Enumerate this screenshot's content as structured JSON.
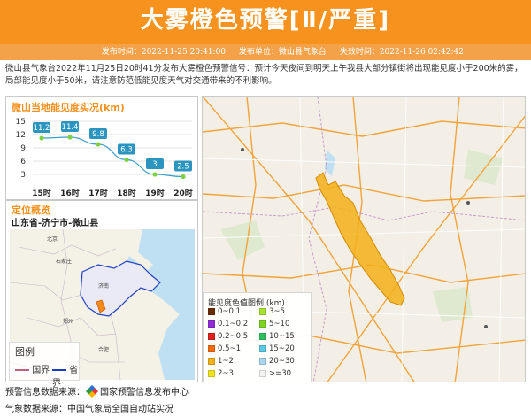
{
  "header": {
    "title": "大雾橙色预警[Ⅱ/严重]",
    "publish_time": "发布时间：2022-11-25 20:41:00",
    "publisher": "发布单位：微山县气象台",
    "expire_time": "失效时间：2022-11-26 02:42:42"
  },
  "description": "微山县气象台2022年11月25日20时41分发布大雾橙色预警信号：预计今天夜间到明天上午我县大部分镇街将出现能见度小于200米的雾，局部能见度小于50米，请注意防范低能见度天气对交通带来的不利影响。",
  "visibility": {
    "title": "微山当地能见度实况(km)",
    "colors": {
      "line": "#3aa0c8",
      "label_bg": "#2b95bf",
      "grid": "#e3e3e3",
      "dot": "#7fd044"
    }
  },
  "chart_data": {
    "type": "line",
    "title": "微山当地能见度实况(km)",
    "categories": [
      "15时",
      "16时",
      "17时",
      "18时",
      "19时",
      "20时"
    ],
    "values": [
      11.2,
      11.4,
      9.8,
      6.3,
      3,
      2.5
    ],
    "y_ticks": [
      "15",
      "12",
      "9",
      "6",
      "3"
    ],
    "ylim": [
      1,
      15
    ],
    "grid": true
  },
  "location": {
    "title": "定位概览",
    "path": "山东省-济宁市-微山县",
    "cities": [
      "北京",
      "石家庄",
      "济南",
      "郑州",
      "合肥"
    ]
  },
  "map_legend": {
    "title": "图例",
    "national_border": "国界",
    "provincial_border": "省界"
  },
  "vis_legend": {
    "title": "能见度色值图例 (km)",
    "items": [
      {
        "label": "0~0.1",
        "color": "#6b2d00"
      },
      {
        "label": "3~5",
        "color": "#a6e22e"
      },
      {
        "label": "0.1~0.2",
        "color": "#8e2bd6"
      },
      {
        "label": "5~10",
        "color": "#7ed321"
      },
      {
        "label": "0.2~0.5",
        "color": "#e0201b"
      },
      {
        "label": "10~15",
        "color": "#2fbf5a"
      },
      {
        "label": "0.5~1",
        "color": "#f26a0c"
      },
      {
        "label": "15~20",
        "color": "#5bc8e8"
      },
      {
        "label": "1~2",
        "color": "#f3b018"
      },
      {
        "label": "20~30",
        "color": "#a9d7f0"
      },
      {
        "label": "2~3",
        "color": "#f1e21f"
      },
      {
        "label": ">=30",
        "color": "#f4f4f4"
      }
    ]
  },
  "footer": {
    "warning_source": "预警信息数据来源：",
    "warning_source_name": "国家预警信息发布中心",
    "weather_source": "气象数据来源：中国气象局全国自动站实况"
  }
}
